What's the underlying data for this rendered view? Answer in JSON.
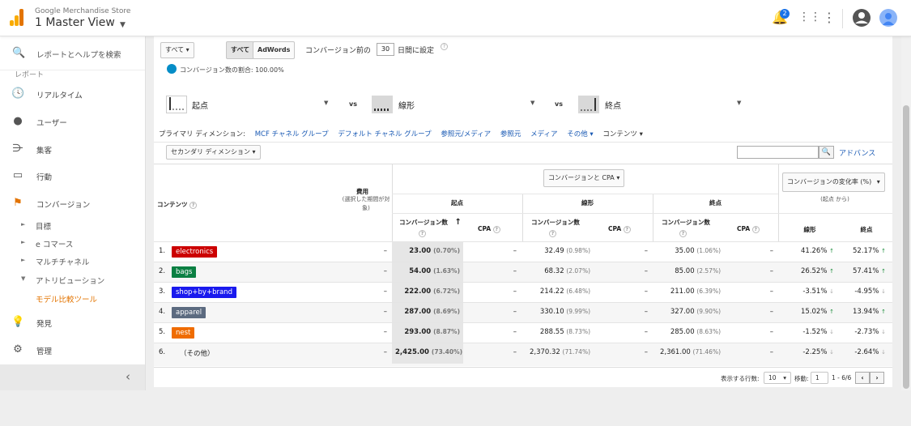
{
  "topbar": {
    "account": "Google Merchandise Store",
    "view": "1 Master View",
    "notifications": "2",
    "colors": {
      "logo_orange": "#f9ab00",
      "logo_dark": "#e37400",
      "avatar": "#4285f4"
    }
  },
  "sidebar": {
    "search_label": "レポートとヘルプを検索",
    "cut_label": "レポート",
    "items": [
      {
        "icon": "clock-icon",
        "label": "リアルタイム"
      },
      {
        "icon": "person-icon",
        "label": "ユーザー"
      },
      {
        "icon": "acquisition-icon",
        "label": "集客"
      },
      {
        "icon": "behavior-icon",
        "label": "行動"
      },
      {
        "icon": "flag-icon",
        "label": "コンバージョン"
      }
    ],
    "subitems": [
      {
        "arrow": "►",
        "label": "目標"
      },
      {
        "arrow": "►",
        "label": "e コマース"
      },
      {
        "arrow": "►",
        "label": "マルチチャネル"
      },
      {
        "arrow": "▼",
        "label": "アトリビューション"
      },
      {
        "arrow": "",
        "label": "モデル比較ツール"
      }
    ],
    "bottom_items": [
      {
        "icon": "lightbulb-icon",
        "label": "発見"
      },
      {
        "icon": "gear-icon",
        "label": "管理"
      }
    ],
    "collapse": "‹"
  },
  "controls": {
    "conversion_select": "すべて",
    "toggle_all": "すべて",
    "toggle_adwords": "AdWords",
    "lookback_prefix": "コンバージョン前の",
    "lookback_value": "30",
    "lookback_suffix": "日間に設定",
    "ratio": "コンバージョン数の割合: 100.00%"
  },
  "models": [
    {
      "name": "起点"
    },
    {
      "name": "線形"
    },
    {
      "name": "終点"
    }
  ],
  "vs": "vs",
  "dimensions": {
    "label": "プライマリ ディメンション:",
    "links": [
      "MCF チャネル グループ",
      "デフォルト チャネル グループ",
      "参照元/メディア",
      "参照元",
      "メディア",
      "その他 ▾"
    ],
    "current": "コンテンツ ▾"
  },
  "secondary_dim": "セカンダリ ディメンション",
  "search_button": "🔍",
  "advanced": "アドバンス",
  "table": {
    "col_content": "コンテンツ",
    "col_spend": "費用",
    "col_spend_sub": "(選択した期間が対象)",
    "metric_select": "コンバージョンと CPA",
    "change_select": "コンバージョンの変化率 (%)",
    "change_sub": "(起点 から)",
    "groups": [
      "起点",
      "線形",
      "終点"
    ],
    "conv_label": "コンバージョン数",
    "cpa_label": "CPA",
    "change_cols": [
      "線形",
      "終点"
    ],
    "rows": [
      {
        "no": "1.",
        "name": "electronics",
        "color": "#cc0000",
        "spend": "–",
        "first": "23.00",
        "first_pct": "(0.70%)",
        "first_cpa": "–",
        "linear": "32.49",
        "linear_pct": "(0.98%)",
        "linear_cpa": "–",
        "last": "35.00",
        "last_pct": "(1.06%)",
        "last_cpa": "–",
        "chg_linear": "41.26%",
        "chg_linear_dir": "↑",
        "chg_last": "52.17%",
        "chg_last_dir": "↑"
      },
      {
        "no": "2.",
        "name": "bags",
        "color": "#0b8043",
        "spend": "–",
        "first": "54.00",
        "first_pct": "(1.63%)",
        "first_cpa": "–",
        "linear": "68.32",
        "linear_pct": "(2.07%)",
        "linear_cpa": "–",
        "last": "85.00",
        "last_pct": "(2.57%)",
        "last_cpa": "–",
        "chg_linear": "26.52%",
        "chg_linear_dir": "↑",
        "chg_last": "57.41%",
        "chg_last_dir": "↑"
      },
      {
        "no": "3.",
        "name": "shop+by+brand",
        "color": "#1a1aee",
        "spend": "–",
        "first": "222.00",
        "first_pct": "(6.72%)",
        "first_cpa": "–",
        "linear": "214.22",
        "linear_pct": "(6.48%)",
        "linear_cpa": "–",
        "last": "211.00",
        "last_pct": "(6.39%)",
        "last_cpa": "–",
        "chg_linear": "-3.51%",
        "chg_linear_dir": "↓",
        "chg_last": "-4.95%",
        "chg_last_dir": "↓"
      },
      {
        "no": "4.",
        "name": "apparel",
        "color": "#5c6b80",
        "spend": "–",
        "first": "287.00",
        "first_pct": "(8.69%)",
        "first_cpa": "–",
        "linear": "330.10",
        "linear_pct": "(9.99%)",
        "linear_cpa": "–",
        "last": "327.00",
        "last_pct": "(9.90%)",
        "last_cpa": "–",
        "chg_linear": "15.02%",
        "chg_linear_dir": "↑",
        "chg_last": "13.94%",
        "chg_last_dir": "↑"
      },
      {
        "no": "5.",
        "name": "nest",
        "color": "#ef6c00",
        "spend": "–",
        "first": "293.00",
        "first_pct": "(8.87%)",
        "first_cpa": "–",
        "linear": "288.55",
        "linear_pct": "(8.73%)",
        "linear_cpa": "–",
        "last": "285.00",
        "last_pct": "(8.63%)",
        "last_cpa": "–",
        "chg_linear": "-1.52%",
        "chg_linear_dir": "↓",
        "chg_last": "-2.73%",
        "chg_last_dir": "↓"
      },
      {
        "no": "6.",
        "name": "（その他）",
        "color": "",
        "spend": "–",
        "first": "2,425.00",
        "first_pct": "(73.40%)",
        "first_cpa": "–",
        "linear": "2,370.32",
        "linear_pct": "(71.74%)",
        "linear_cpa": "–",
        "last": "2,361.00",
        "last_pct": "(71.46%)",
        "last_cpa": "–",
        "chg_linear": "-2.25%",
        "chg_linear_dir": "↓",
        "chg_last": "-2.64%",
        "chg_last_dir": "↓"
      }
    ]
  },
  "footer": {
    "rows_label": "表示する行数:",
    "rows_value": "10",
    "goto_label": "移動:",
    "goto_value": "1",
    "range": "1 - 6/6",
    "prev": "‹",
    "next": "›"
  }
}
